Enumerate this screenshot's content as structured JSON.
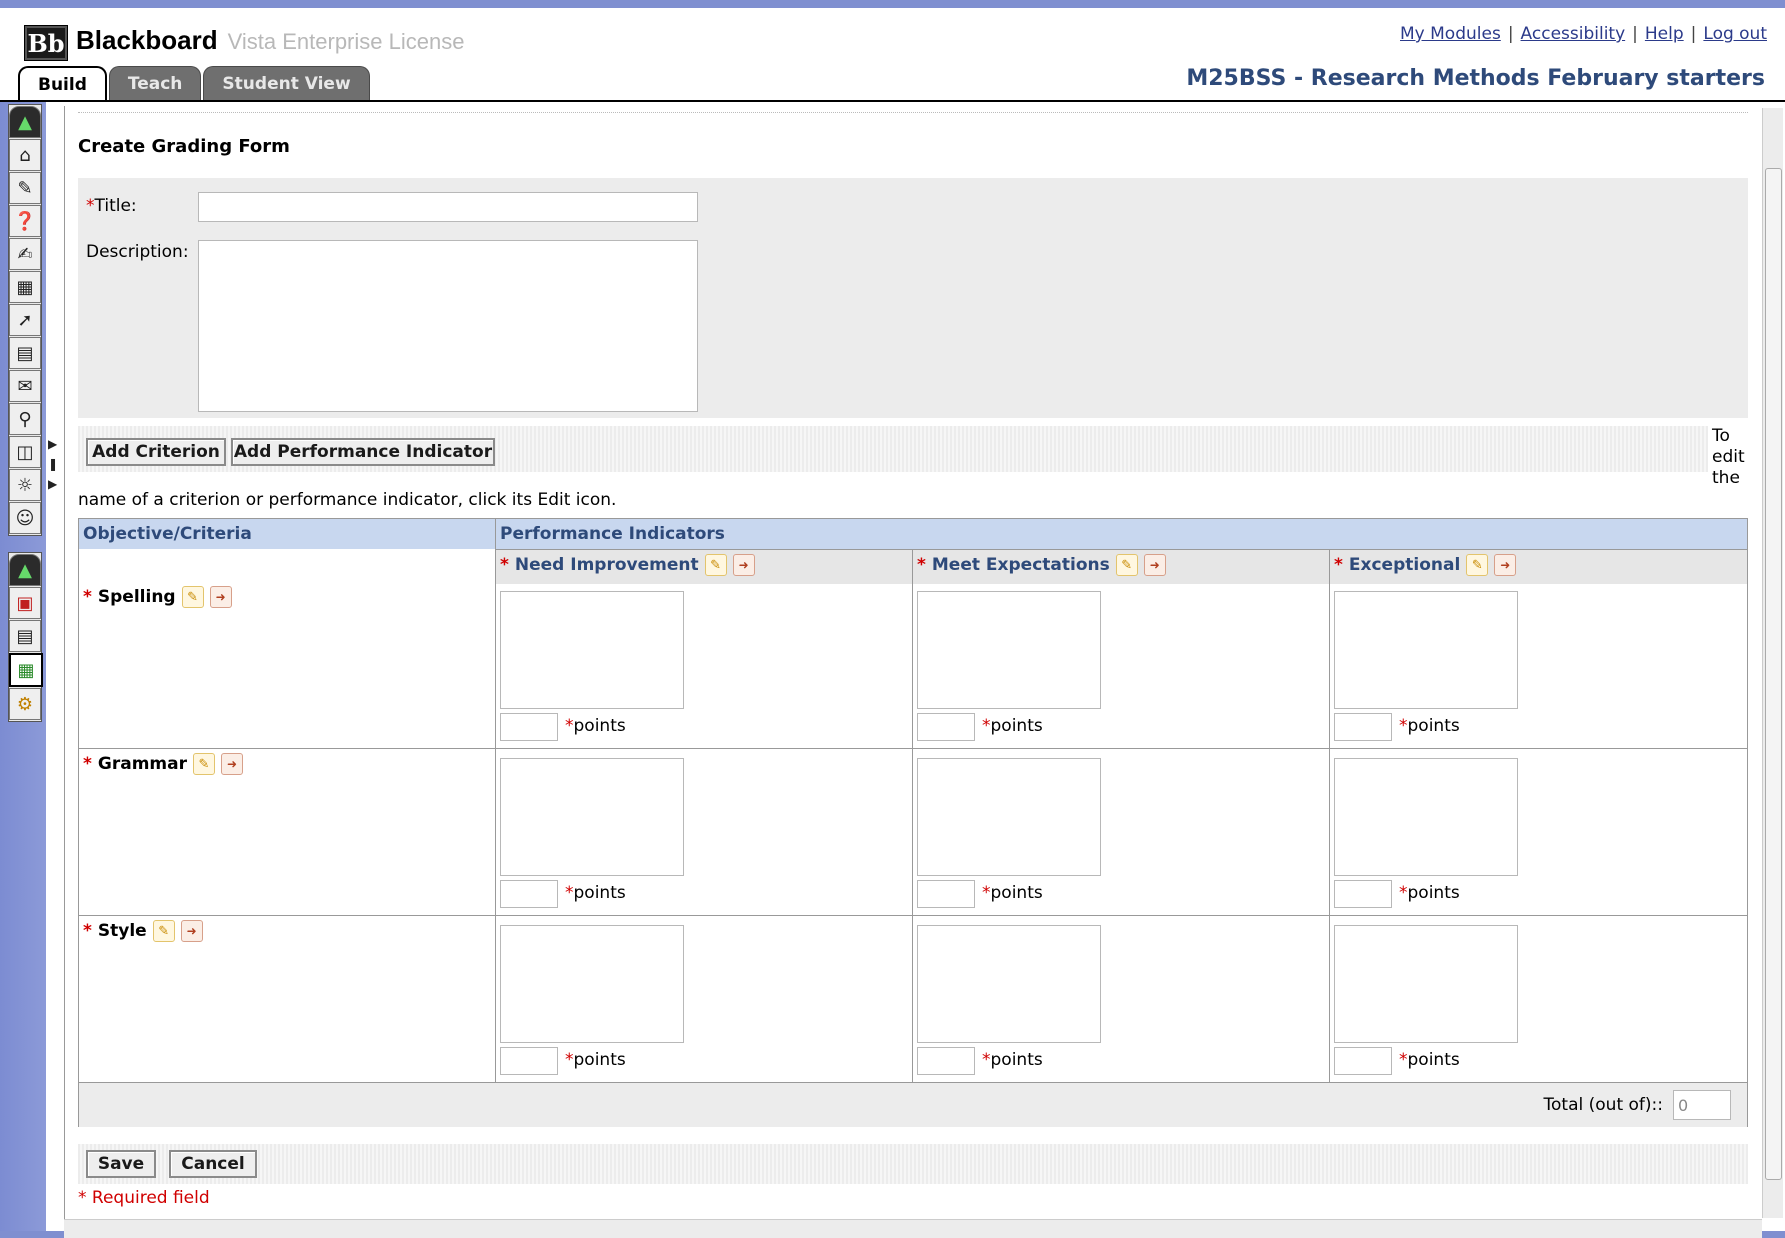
{
  "brand": {
    "logo_mark": "Bb",
    "name": "Blackboard",
    "subtitle": "Vista Enterprise License"
  },
  "top_links": [
    "My Modules",
    "Accessibility",
    "Help",
    "Log out"
  ],
  "course_title": "M25BSS - Research Methods February starters",
  "tabs": [
    {
      "label": "Build",
      "active": true
    },
    {
      "label": "Teach"
    },
    {
      "label": "Student View"
    }
  ],
  "rail_icons": [
    "collapse-icon",
    "home-icon",
    "tools-icon",
    "quiz-icon",
    "edit-icon",
    "calendar-icon",
    "pin-icon",
    "documents-icon",
    "mail-icon",
    "search-icon",
    "files-icon",
    "web-icon",
    "roster-icon"
  ],
  "rail_icons_2": [
    "collapse-icon",
    "books-icon",
    "gradebook-icon",
    "grading-form-icon",
    "tracking-icon"
  ],
  "page": {
    "heading": "Create Grading Form",
    "title_label": "Title:",
    "description_label": "Description:",
    "title_value": "",
    "description_value": ""
  },
  "buttons": {
    "add_criterion": "Add Criterion",
    "add_indicator": "Add Performance Indicator",
    "save": "Save",
    "cancel": "Cancel"
  },
  "note_right": "To edit the",
  "note_left": "name of a criterion or performance indicator, click its Edit icon.",
  "required_mark": "*",
  "table": {
    "col_criteria": "Objective/Criteria",
    "col_indicators": "Performance Indicators",
    "indicators": [
      "Need Improvement",
      "Meet Expectations",
      "Exceptional"
    ],
    "criteria": [
      "Spelling",
      "Grammar",
      "Style"
    ],
    "points_label": "points",
    "total_label": "Total (out of)::",
    "total_value": "0"
  },
  "required_note": "* Required field"
}
